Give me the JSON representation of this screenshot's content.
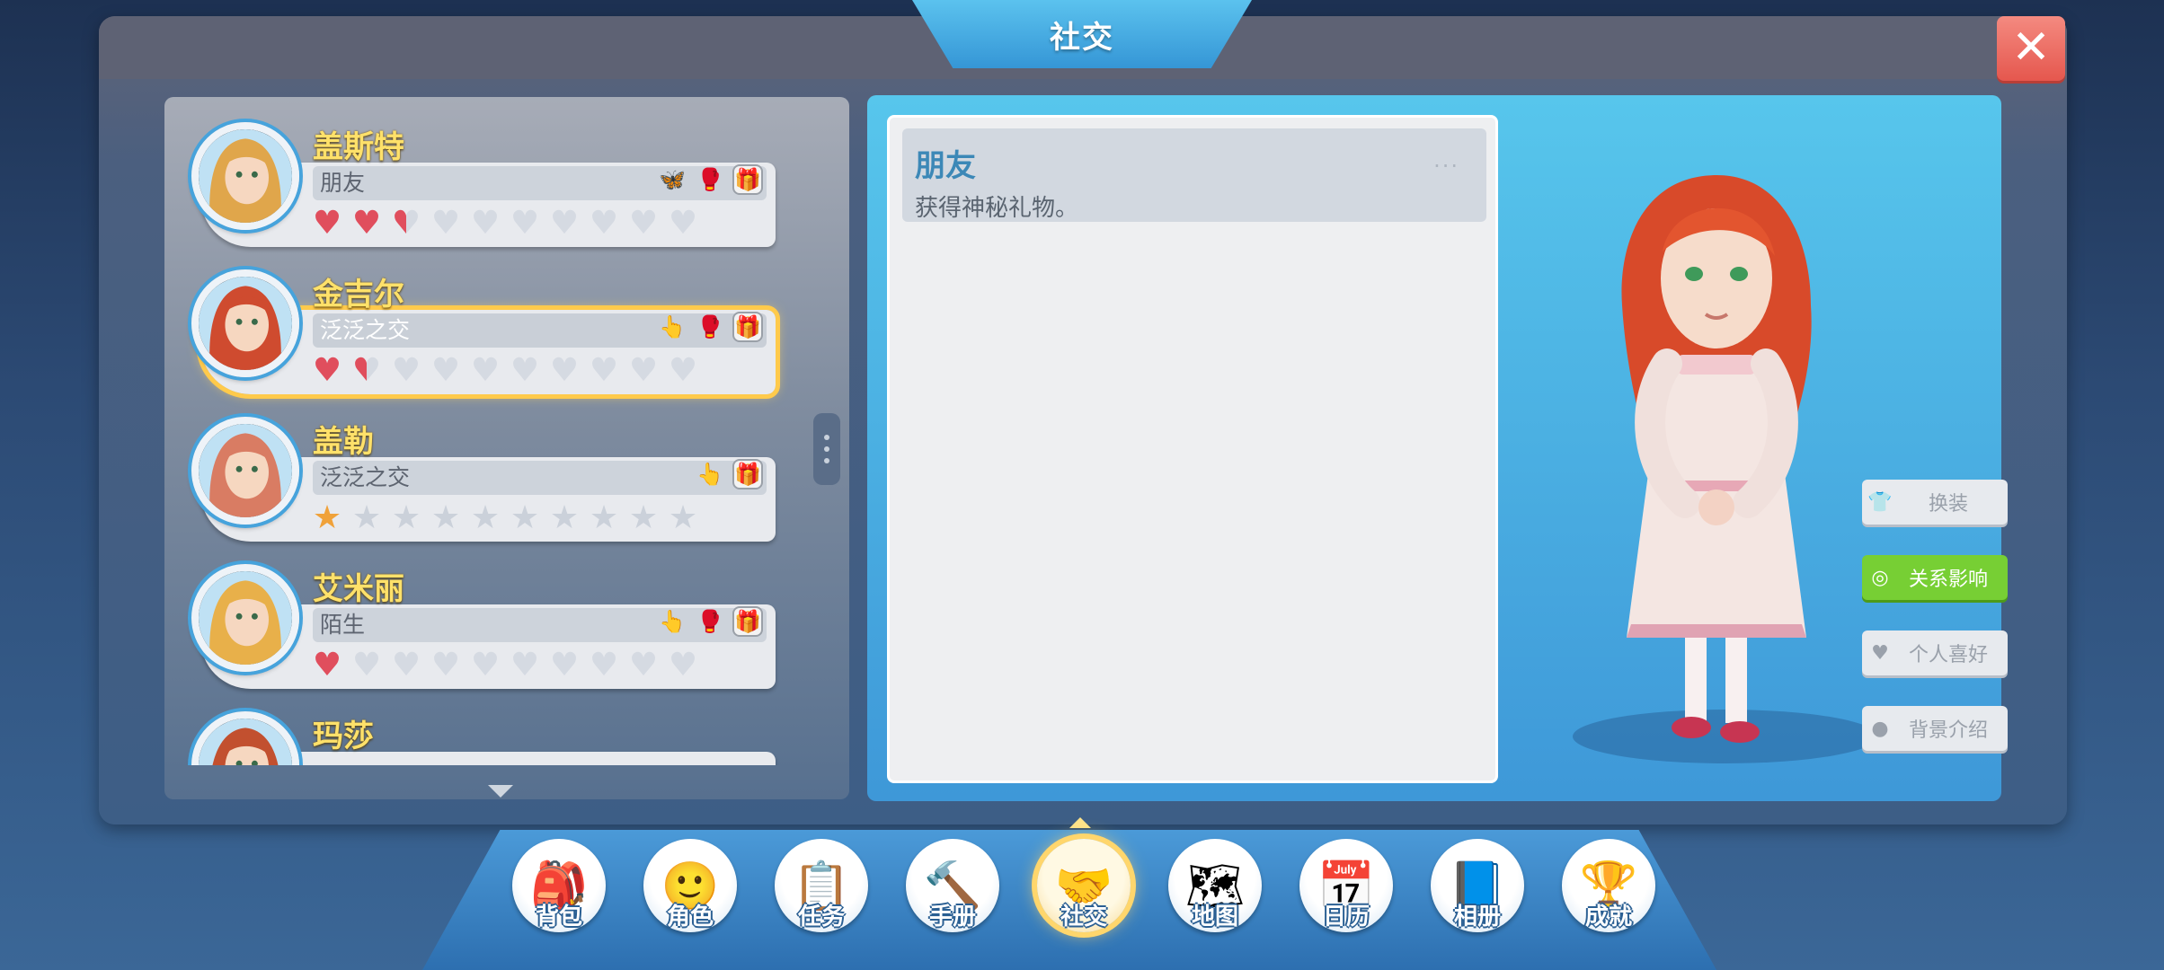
{
  "header": {
    "title": "社交",
    "close_label": "✕"
  },
  "npc_list": [
    {
      "name": "盖斯特",
      "status": "朋友",
      "tags": [
        "butterfly-icon",
        "boxing-glove-icon",
        "gift-icon"
      ],
      "rating": {
        "type": "hearts",
        "filled": 2.5,
        "total": 10
      },
      "hair": "#e0a64b",
      "selected": false
    },
    {
      "name": "金吉尔",
      "status": "泛泛之交",
      "tags": [
        "finger-icon",
        "boxing-glove-icon",
        "gift-icon"
      ],
      "rating": {
        "type": "hearts",
        "filled": 1.5,
        "total": 10
      },
      "hair": "#cf4b2f",
      "selected": true
    },
    {
      "name": "盖勒",
      "status": "泛泛之交",
      "tags": [
        "finger-icon",
        "gift-icon"
      ],
      "rating": {
        "type": "stars",
        "filled": 1,
        "total": 10
      },
      "hair": "#d97c63",
      "selected": false
    },
    {
      "name": "艾米丽",
      "status": "陌生",
      "tags": [
        "finger-icon",
        "boxing-glove-icon",
        "gift-icon"
      ],
      "rating": {
        "type": "hearts",
        "filled": 1,
        "total": 10
      },
      "hair": "#e8b04a",
      "selected": false
    },
    {
      "name": "玛莎",
      "status": "",
      "tags": [],
      "rating": {
        "type": "hearts",
        "filled": 0,
        "total": 0
      },
      "hair": "#c2502f",
      "selected": false
    }
  ],
  "detail": {
    "title": "朋友",
    "description": "获得神秘礼物。",
    "more": "···"
  },
  "side_buttons": [
    {
      "label": "换装",
      "icon": "outfit-icon",
      "active": false
    },
    {
      "label": "关系影响",
      "icon": "relation-icon",
      "active": true
    },
    {
      "label": "个人喜好",
      "icon": "heart-like-icon",
      "active": false
    },
    {
      "label": "背景介绍",
      "icon": "profile-icon",
      "active": false
    }
  ],
  "nav": [
    {
      "label": "背包",
      "icon": "backpack-icon",
      "glyph": "🎒",
      "active": false
    },
    {
      "label": "角色",
      "icon": "character-icon",
      "glyph": "🙂",
      "active": false
    },
    {
      "label": "任务",
      "icon": "task-clipboard-icon",
      "glyph": "📋",
      "active": false
    },
    {
      "label": "手册",
      "icon": "hammer-icon",
      "glyph": "🔨",
      "active": false
    },
    {
      "label": "社交",
      "icon": "handshake-icon",
      "glyph": "🤝",
      "active": true
    },
    {
      "label": "地图",
      "icon": "map-icon",
      "glyph": "🗺",
      "active": false
    },
    {
      "label": "日历",
      "icon": "calendar-icon",
      "glyph": "📅",
      "active": false
    },
    {
      "label": "相册",
      "icon": "album-icon",
      "glyph": "📘",
      "active": false
    },
    {
      "label": "成就",
      "icon": "trophy-icon",
      "glyph": "🏆",
      "active": false
    }
  ],
  "colors": {
    "accent_blue": "#3e98d8",
    "selected_outline": "#ffca4b",
    "active_green": "#77cf34",
    "heart_red": "#e04e5d",
    "name_yellow": "#ffe16a"
  }
}
